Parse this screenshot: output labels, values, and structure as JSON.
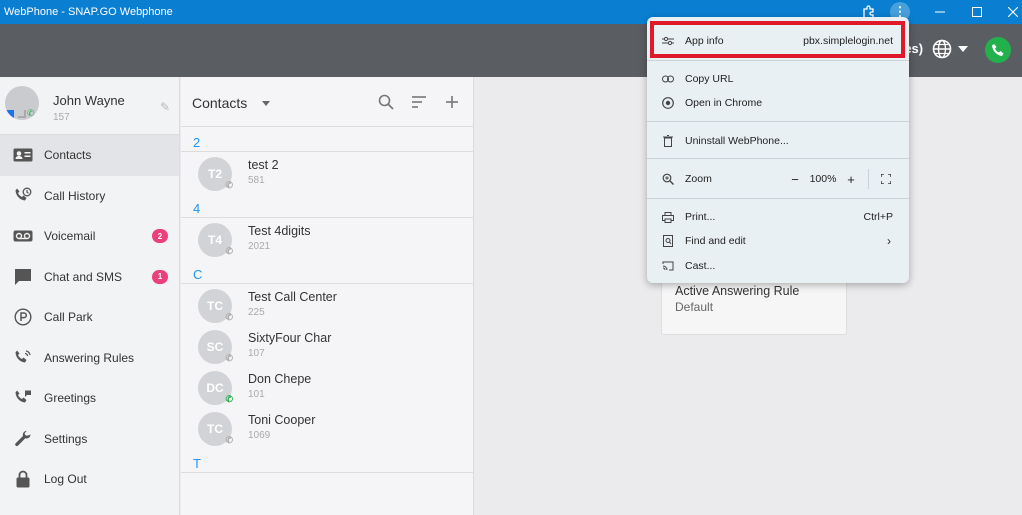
{
  "window": {
    "title": "WebPhone - SNAP.GO Webphone"
  },
  "header": {
    "timezone_fragment": "tes)"
  },
  "profile": {
    "name": "John Wayne",
    "extension": "157"
  },
  "nav": [
    {
      "label": "Contacts",
      "icon": "contacts-icon"
    },
    {
      "label": "Call History",
      "icon": "call-history-icon"
    },
    {
      "label": "Voicemail",
      "icon": "voicemail-icon",
      "badge": "2"
    },
    {
      "label": "Chat and SMS",
      "icon": "chat-icon",
      "badge": "1"
    },
    {
      "label": "Call Park",
      "icon": "call-park-icon"
    },
    {
      "label": "Answering Rules",
      "icon": "answering-rules-icon"
    },
    {
      "label": "Greetings",
      "icon": "greetings-icon"
    },
    {
      "label": "Settings",
      "icon": "wrench-icon"
    },
    {
      "label": "Log Out",
      "icon": "lock-icon"
    }
  ],
  "contacts": {
    "title": "Contacts",
    "sections": [
      {
        "letter": "2",
        "items": [
          {
            "initials": "T2",
            "name": "test 2",
            "number": "581"
          }
        ]
      },
      {
        "letter": "4",
        "items": [
          {
            "initials": "T4",
            "name": "Test 4digits",
            "number": "2021"
          }
        ]
      },
      {
        "letter": "C",
        "items": [
          {
            "initials": "TC",
            "name": "Test Call Center",
            "number": "225"
          },
          {
            "initials": "SC",
            "name": "SixtyFour Char",
            "number": "107"
          },
          {
            "initials": "DC",
            "name": "Don Chepe",
            "number": "101"
          },
          {
            "initials": "TC",
            "name": "Toni Cooper",
            "number": "1069"
          }
        ]
      },
      {
        "letter": "T",
        "items": []
      }
    ]
  },
  "answering_card": {
    "title": "Active Answering Rule",
    "value": "Default"
  },
  "menu": {
    "app_info": {
      "label": "App info",
      "value": "pbx.simplelogin.net"
    },
    "copy_url": "Copy URL",
    "open_in_chrome": "Open in Chrome",
    "uninstall": "Uninstall WebPhone...",
    "zoom": {
      "label": "Zoom",
      "value": "100%",
      "minus": "−",
      "plus": "+"
    },
    "print": {
      "label": "Print...",
      "shortcut": "Ctrl+P"
    },
    "find_edit": "Find and edit",
    "cast": "Cast..."
  },
  "colors": {
    "titlebar": "#0a7fd1",
    "header": "#5a5d62",
    "accent": "#2196f3",
    "badge": "#ec407a",
    "highlight": "#e0192a",
    "sip": "#22b14c"
  }
}
